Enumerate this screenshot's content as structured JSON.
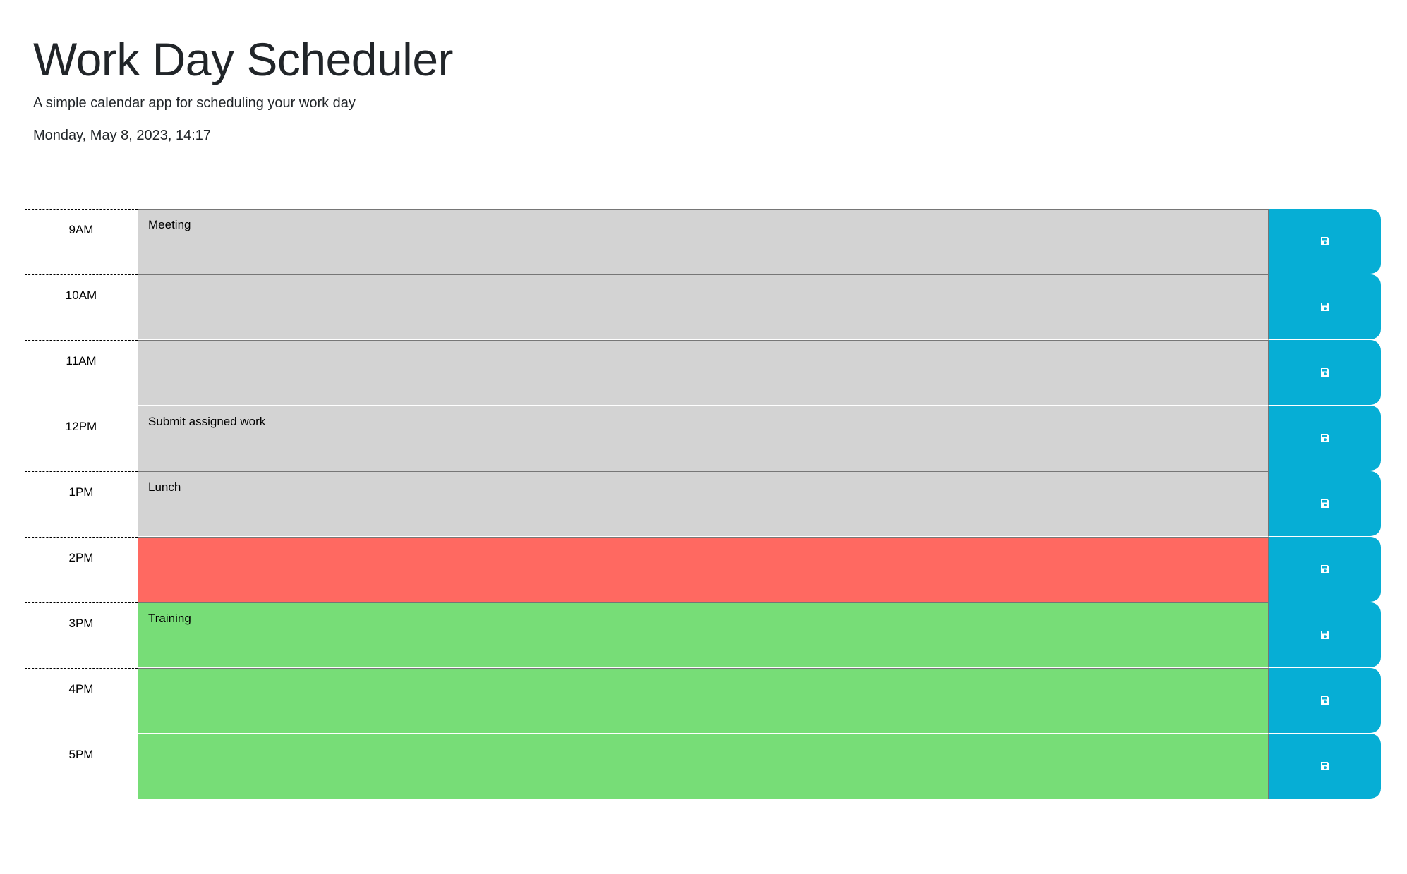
{
  "header": {
    "title": "Work Day Scheduler",
    "subtitle": "A simple calendar app for scheduling your work day",
    "current_date": "Monday, May 8, 2023, 14:17"
  },
  "colors": {
    "past": "#d3d3d3",
    "present": "#ff6961",
    "future": "#77dd77",
    "save_button": "#06aed5"
  },
  "save_icon": "floppy-disk-icon",
  "time_blocks": [
    {
      "hour": "9AM",
      "text": "Meeting",
      "status": "past"
    },
    {
      "hour": "10AM",
      "text": "",
      "status": "past"
    },
    {
      "hour": "11AM",
      "text": "",
      "status": "past"
    },
    {
      "hour": "12PM",
      "text": "Submit assigned work",
      "status": "past"
    },
    {
      "hour": "1PM",
      "text": "Lunch",
      "status": "past"
    },
    {
      "hour": "2PM",
      "text": "",
      "status": "present"
    },
    {
      "hour": "3PM",
      "text": "Training",
      "status": "future"
    },
    {
      "hour": "4PM",
      "text": "",
      "status": "future"
    },
    {
      "hour": "5PM",
      "text": "",
      "status": "future"
    }
  ]
}
